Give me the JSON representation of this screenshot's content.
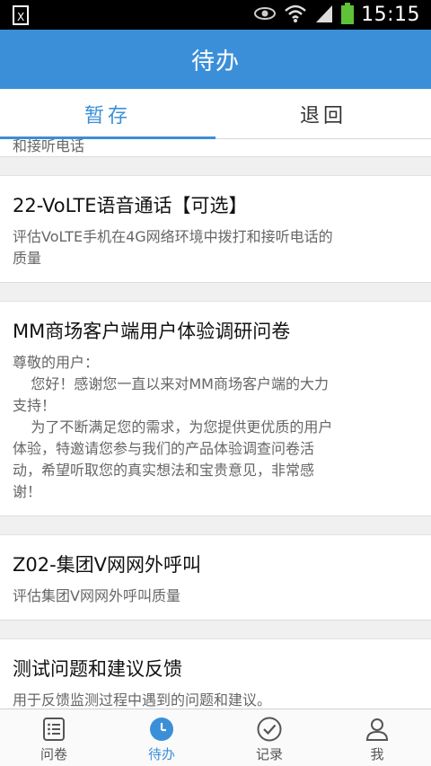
{
  "status_bar": {
    "time": "15:15",
    "icons": [
      "nfc-icon",
      "eye-icon",
      "wifi-icon",
      "signal-icon",
      "battery-icon"
    ],
    "battery_color": "#5fc238"
  },
  "app_bar": {
    "title": "待办",
    "color": "#3b8fd8"
  },
  "tabs": [
    {
      "label": "暂存",
      "active": true
    },
    {
      "label": "退回",
      "active": false
    }
  ],
  "list": {
    "partial_desc": "和接听电话",
    "items": [
      {
        "title": "22-VoLTE语音通话【可选】",
        "desc": "评估VoLTE手机在4G网络环境中拨打和接听电话的\n质量"
      },
      {
        "title": "MM商场客户端用户体验调研问卷",
        "desc": "尊敬的用户：\n    您好！感谢您一直以来对MM商场客户端的大力\n支持！\n    为了不断满足您的需求，为您提供更优质的用户\n体验，特邀请您参与我们的产品体验调查问卷活\n动，希望听取您的真实想法和宝贵意见，非常感\n谢！"
      },
      {
        "title": "Z02-集团V网网外呼叫",
        "desc": "评估集团V网网外呼叫质量"
      },
      {
        "title": "测试问题和建议反馈",
        "desc": "用于反馈监测过程中遇到的问题和建议。"
      }
    ]
  },
  "bottom_nav": [
    {
      "label": "问卷",
      "icon": "list-icon",
      "active": false
    },
    {
      "label": "待办",
      "icon": "clock-icon",
      "active": true
    },
    {
      "label": "记录",
      "icon": "check-circle-icon",
      "active": false
    },
    {
      "label": "我",
      "icon": "person-icon",
      "active": false
    }
  ]
}
